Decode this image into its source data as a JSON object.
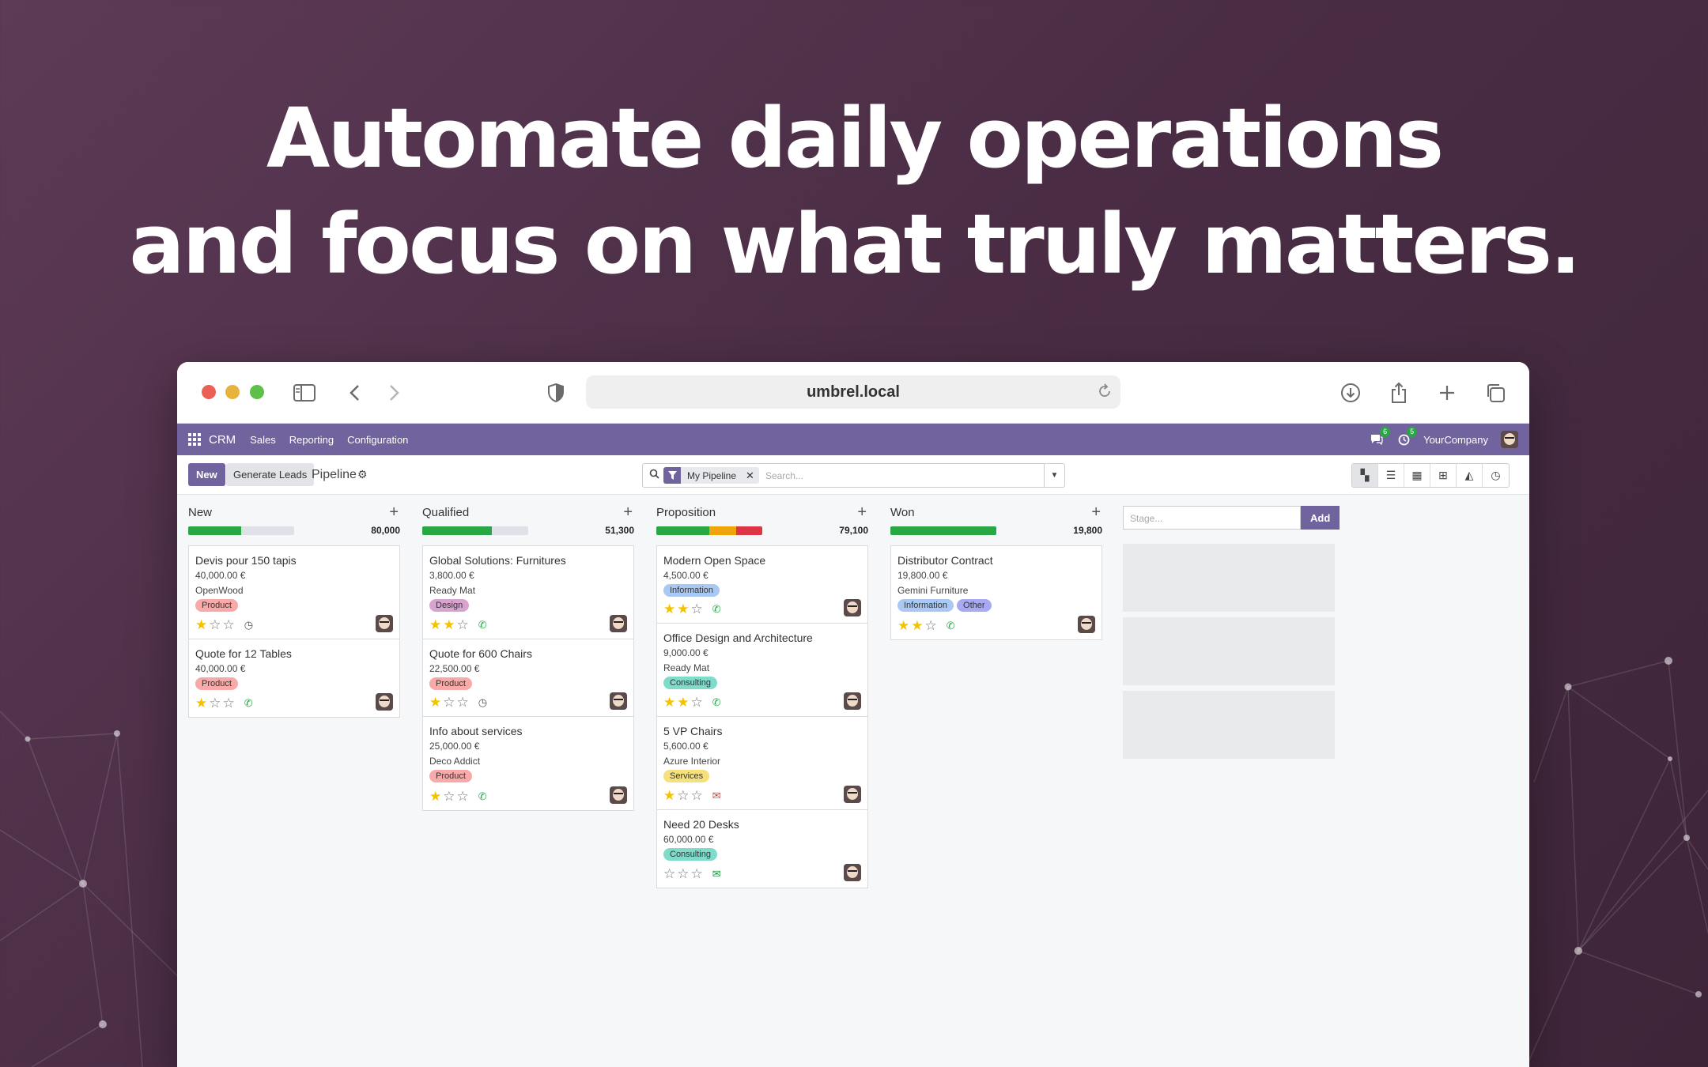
{
  "headline": {
    "line1": "Automate daily operations",
    "line2": "and focus on what truly matters."
  },
  "browser": {
    "url": "umbrel.local"
  },
  "topnav": {
    "app": "CRM",
    "menus": [
      "Sales",
      "Reporting",
      "Configuration"
    ],
    "messages_count": "6",
    "activities_count": "5",
    "company": "YourCompany"
  },
  "control": {
    "new_label": "New",
    "generate_label": "Generate Leads",
    "breadcrumb": "Pipeline",
    "filter_facet": "My Pipeline",
    "search_placeholder": "Search..."
  },
  "stage_input": {
    "placeholder": "Stage...",
    "add_label": "Add"
  },
  "colors": {
    "accent": "#71639e",
    "green": "#28a745",
    "orange": "#f0a30a",
    "red": "#dc3545"
  },
  "columns": [
    {
      "name": "New",
      "total": "80,000",
      "progress": [
        {
          "color": "#28a745",
          "fraction": 0.5
        }
      ],
      "cards": [
        {
          "title": "Devis pour 150 tapis",
          "value": "40,000.00 €",
          "partner": "OpenWood",
          "tags": [
            {
              "label": "Product",
              "color": "#f8a9a9"
            }
          ],
          "stars": 1,
          "activity": "clock"
        },
        {
          "title": "Quote for 12 Tables",
          "value": "40,000.00 €",
          "partner": "",
          "tags": [
            {
              "label": "Product",
              "color": "#f8a9a9"
            }
          ],
          "stars": 1,
          "activity": "phone"
        }
      ]
    },
    {
      "name": "Qualified",
      "total": "51,300",
      "progress": [
        {
          "color": "#28a745",
          "fraction": 0.66
        }
      ],
      "cards": [
        {
          "title": "Global Solutions: Furnitures",
          "value": "3,800.00 €",
          "partner": "Ready Mat",
          "tags": [
            {
              "label": "Design",
              "color": "#d9a3d0"
            }
          ],
          "stars": 2,
          "activity": "phone"
        },
        {
          "title": "Quote for 600 Chairs",
          "value": "22,500.00 €",
          "partner": "",
          "tags": [
            {
              "label": "Product",
              "color": "#f8a9a9"
            }
          ],
          "stars": 1,
          "activity": "clock"
        },
        {
          "title": "Info about services",
          "value": "25,000.00 €",
          "partner": "Deco Addict",
          "tags": [
            {
              "label": "Product",
              "color": "#f8a9a9"
            }
          ],
          "stars": 1,
          "activity": "phone"
        }
      ]
    },
    {
      "name": "Proposition",
      "total": "79,100",
      "progress": [
        {
          "color": "#28a745",
          "fraction": 0.5
        },
        {
          "color": "#f0a30a",
          "fraction": 0.25
        },
        {
          "color": "#dc3545",
          "fraction": 0.25
        }
      ],
      "cards": [
        {
          "title": "Modern Open Space",
          "value": "4,500.00 €",
          "partner": "",
          "tags": [
            {
              "label": "Information",
              "color": "#a9c8f3"
            }
          ],
          "stars": 2,
          "activity": "phone"
        },
        {
          "title": "Office Design and Architecture",
          "value": "9,000.00 €",
          "partner": "Ready Mat",
          "tags": [
            {
              "label": "Consulting",
              "color": "#7fdccb"
            }
          ],
          "stars": 2,
          "activity": "phone"
        },
        {
          "title": "5 VP Chairs",
          "value": "5,600.00 €",
          "partner": "Azure Interior",
          "tags": [
            {
              "label": "Services",
              "color": "#f6e07c"
            }
          ],
          "stars": 1,
          "activity": "mail"
        },
        {
          "title": "Need 20 Desks",
          "value": "60,000.00 €",
          "partner": "",
          "tags": [
            {
              "label": "Consulting",
              "color": "#7fdccb"
            }
          ],
          "stars": 0,
          "activity": "mailg"
        }
      ]
    },
    {
      "name": "Won",
      "total": "19,800",
      "progress": [
        {
          "color": "#28a745",
          "fraction": 1
        }
      ],
      "cards": [
        {
          "title": "Distributor Contract",
          "value": "19,800.00 €",
          "partner": "Gemini Furniture",
          "tags": [
            {
              "label": "Information",
              "color": "#a9c8f3"
            },
            {
              "label": "Other",
              "color": "#a8a9f3"
            }
          ],
          "stars": 2,
          "activity": "phone"
        }
      ]
    }
  ]
}
